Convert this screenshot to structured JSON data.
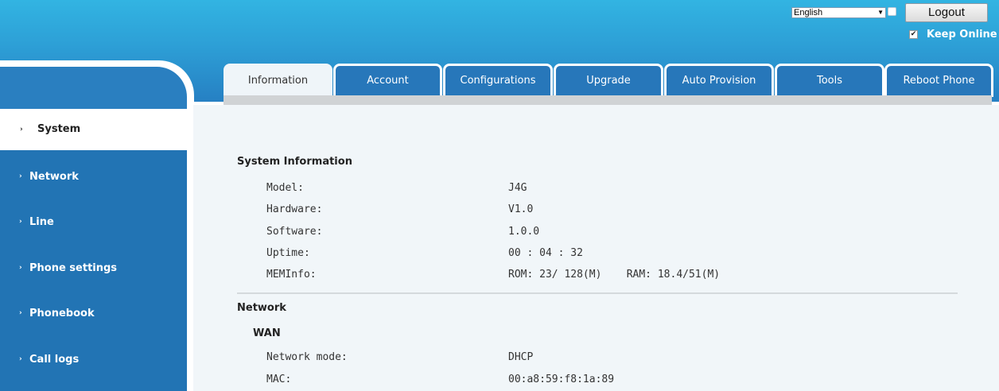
{
  "header": {
    "language_selected": "English",
    "logout_label": "Logout",
    "keep_online_label": "Keep Online",
    "keep_online_checked": true
  },
  "tabs": [
    {
      "label": "Information",
      "active": true
    },
    {
      "label": "Account",
      "active": false
    },
    {
      "label": "Configurations",
      "active": false
    },
    {
      "label": "Upgrade",
      "active": false
    },
    {
      "label": "Auto Provision",
      "active": false
    },
    {
      "label": "Tools",
      "active": false
    },
    {
      "label": "Reboot Phone",
      "active": false
    }
  ],
  "sidebar": {
    "items": [
      {
        "label": "System",
        "active": true
      },
      {
        "label": "Network",
        "active": false
      },
      {
        "label": "Line",
        "active": false
      },
      {
        "label": "Phone settings",
        "active": false
      },
      {
        "label": "Phonebook",
        "active": false
      },
      {
        "label": "Call logs",
        "active": false
      }
    ]
  },
  "system_info": {
    "title": "System Information",
    "rows": [
      {
        "label": "Model:",
        "value": "J4G"
      },
      {
        "label": "Hardware:",
        "value": "V1.0"
      },
      {
        "label": "Software:",
        "value": "1.0.0"
      },
      {
        "label": "Uptime:",
        "value": "00 : 04 : 32"
      },
      {
        "label": "MEMInfo:",
        "value": "ROM: 23/ 128(M)    RAM: 18.4/51(M)"
      }
    ]
  },
  "network": {
    "title": "Network",
    "wan_title": "WAN",
    "rows": [
      {
        "label": "Network mode:",
        "value": "DHCP"
      },
      {
        "label": "MAC:",
        "value": "00:a8:59:f8:1a:89"
      }
    ]
  },
  "colors": {
    "header_blue": "#2d9fd6",
    "tab_blue": "#2777ba",
    "sidebar_blue": "#2274b4",
    "content_bg": "#f1f6f9"
  }
}
